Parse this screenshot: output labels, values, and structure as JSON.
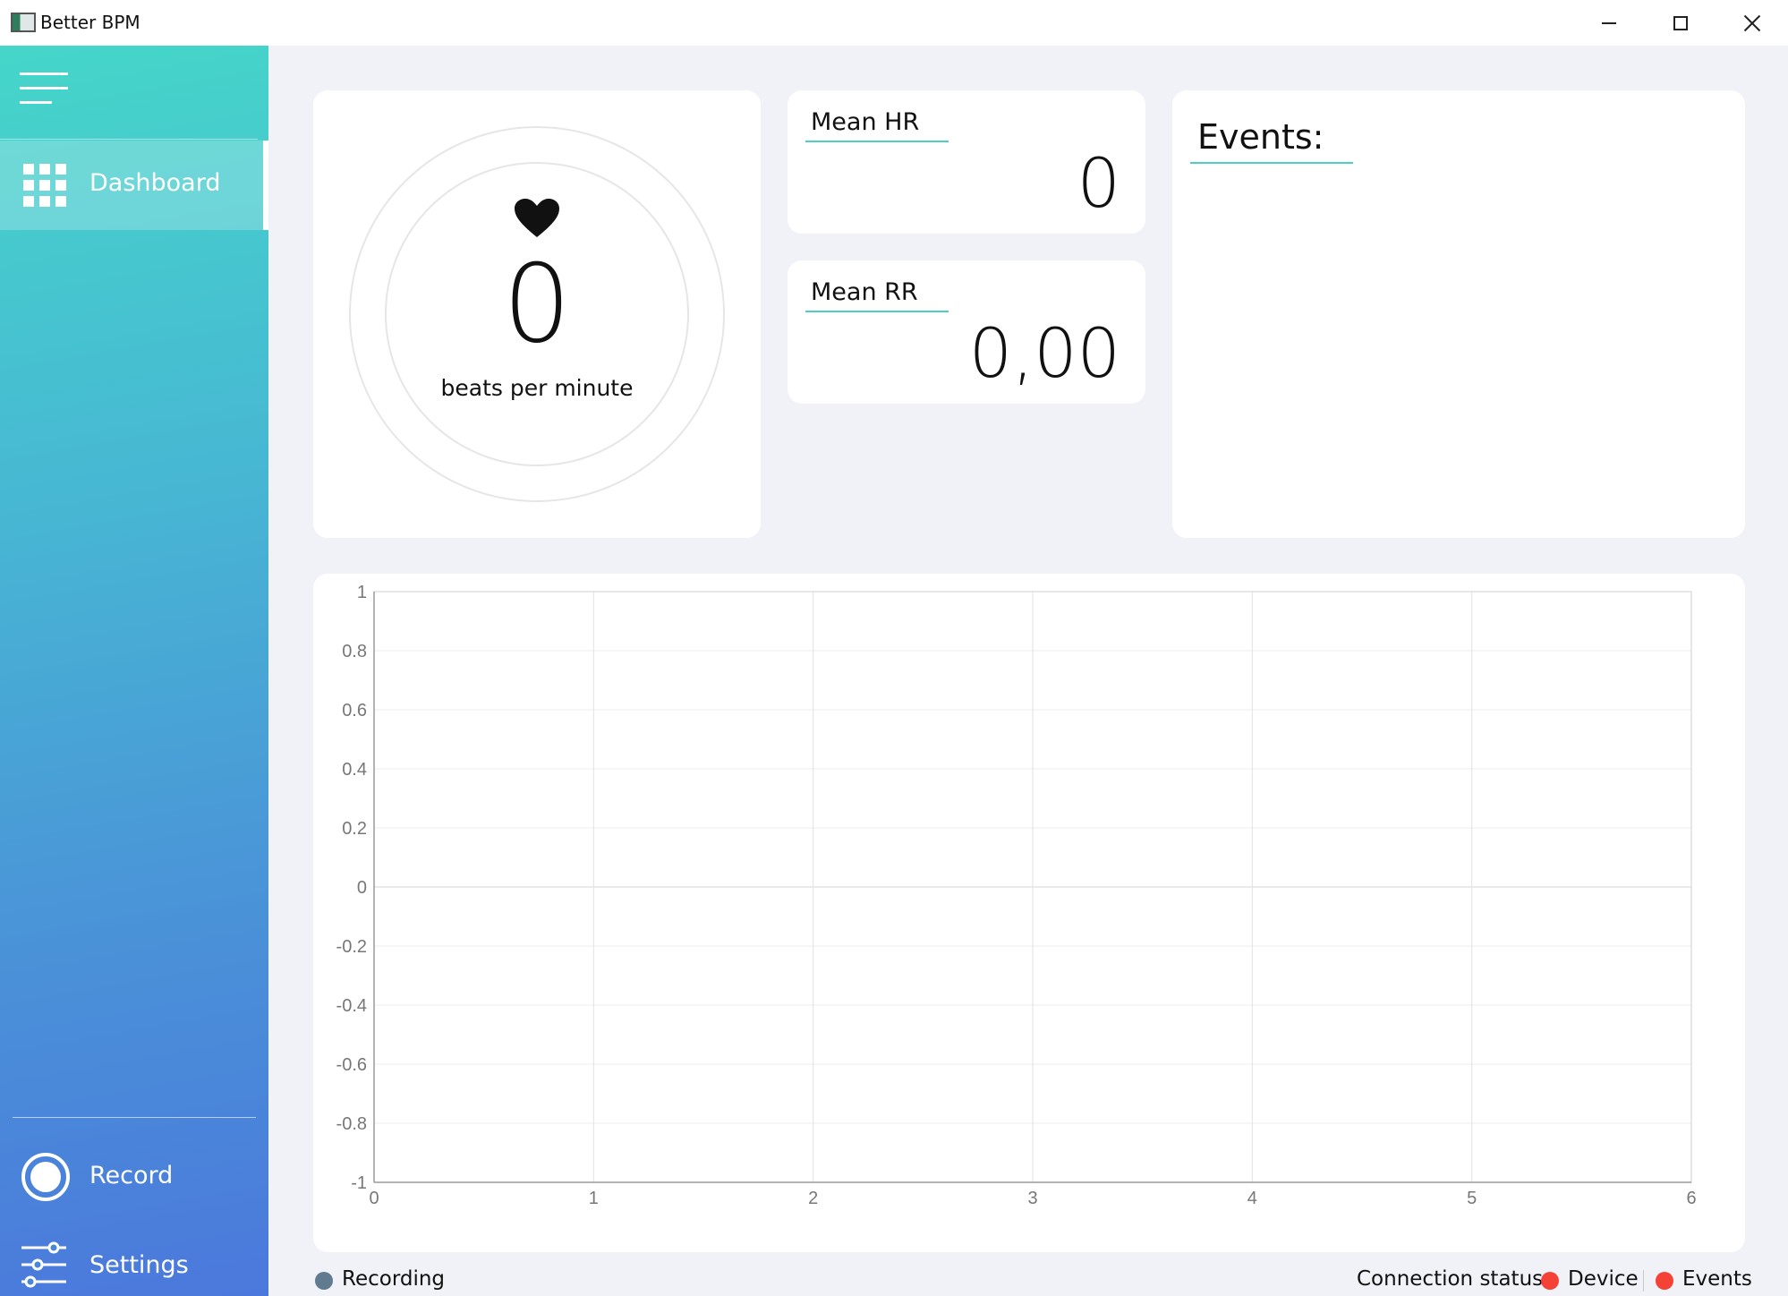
{
  "window": {
    "title": "Better BPM"
  },
  "sidebar": {
    "items": [
      {
        "label": "Dashboard",
        "icon": "grid-icon",
        "active": true
      },
      {
        "label": "Record",
        "icon": "record-icon"
      },
      {
        "label": "Settings",
        "icon": "sliders-icon"
      }
    ]
  },
  "bpm": {
    "value": "0",
    "unit_label": "beats per minute"
  },
  "mean_hr": {
    "title": "Mean HR",
    "value": "0"
  },
  "mean_rr": {
    "title": "Mean RR",
    "value": "0,00"
  },
  "events": {
    "title": "Events:"
  },
  "status": {
    "recording_label": "Recording",
    "connection_label": "Connection status:",
    "device_label": "Device",
    "events_label": "Events"
  },
  "colors": {
    "accent": "#4fcfc1",
    "sidebar_top": "#45d6c9",
    "sidebar_bottom": "#4b78dc",
    "status_red": "#f44336",
    "recording_dot": "#607b8f",
    "background": "#f0f2f7"
  },
  "chart_data": {
    "type": "line",
    "series": [],
    "x_ticks": [
      "0",
      "1",
      "2",
      "3",
      "4",
      "5",
      "6"
    ],
    "y_ticks": [
      "1",
      "0.8",
      "0.6",
      "0.4",
      "0.2",
      "0",
      "-0.2",
      "-0.4",
      "-0.6",
      "-0.8",
      "-1"
    ],
    "xlim": [
      0,
      6
    ],
    "ylim": [
      -1,
      1
    ],
    "grid": true
  }
}
